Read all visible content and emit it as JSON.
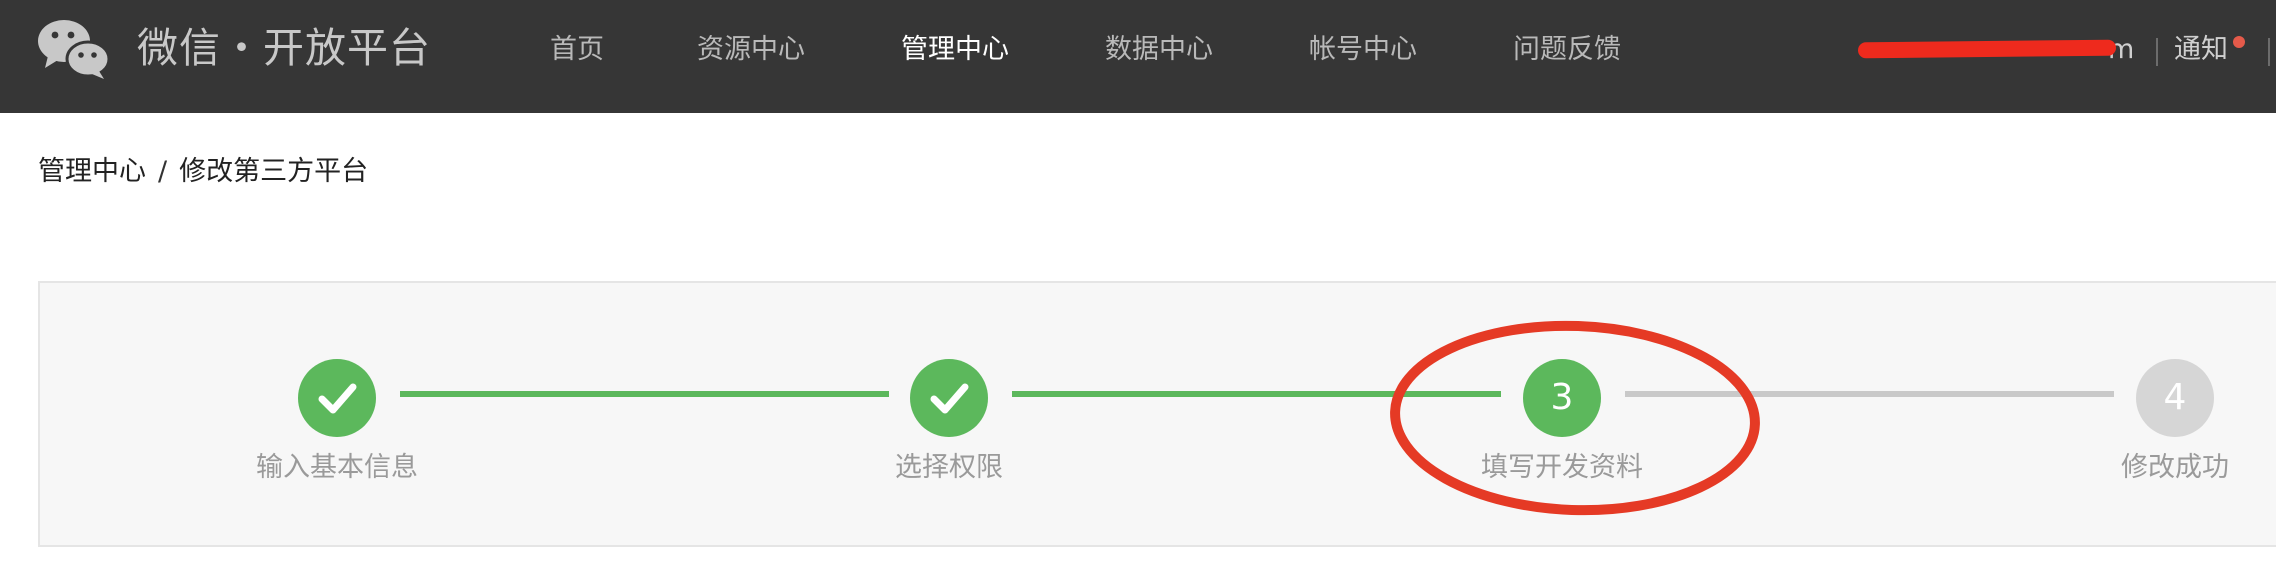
{
  "brand": {
    "title": "微信・开放平台",
    "logo_icon": "wechat-logo-icon"
  },
  "nav": {
    "items": [
      {
        "label": "首页",
        "active": false
      },
      {
        "label": "资源中心",
        "active": false
      },
      {
        "label": "管理中心",
        "active": true
      },
      {
        "label": "数据中心",
        "active": false
      },
      {
        "label": "帐号中心",
        "active": false
      },
      {
        "label": "问题反馈",
        "active": false
      }
    ]
  },
  "user": {
    "email_visible_fragment": "m",
    "notify_label": "通知",
    "notify_dot_color": "#e55a4a",
    "redaction_color": "#ee2a1d"
  },
  "breadcrumb": {
    "parent": "管理中心",
    "separator": "/",
    "current": "修改第三方平台"
  },
  "steps": {
    "items": [
      {
        "label": "输入基本信息",
        "state": "done",
        "icon": "check-icon"
      },
      {
        "label": "选择权限",
        "state": "done",
        "icon": "check-icon"
      },
      {
        "label": "填写开发资料",
        "state": "current",
        "number": "3"
      },
      {
        "label": "修改成功",
        "state": "todo",
        "number": "4"
      }
    ],
    "done_color": "#5cb85c",
    "todo_color": "#d6d6d6",
    "annotation": "red-circle-annotation"
  }
}
